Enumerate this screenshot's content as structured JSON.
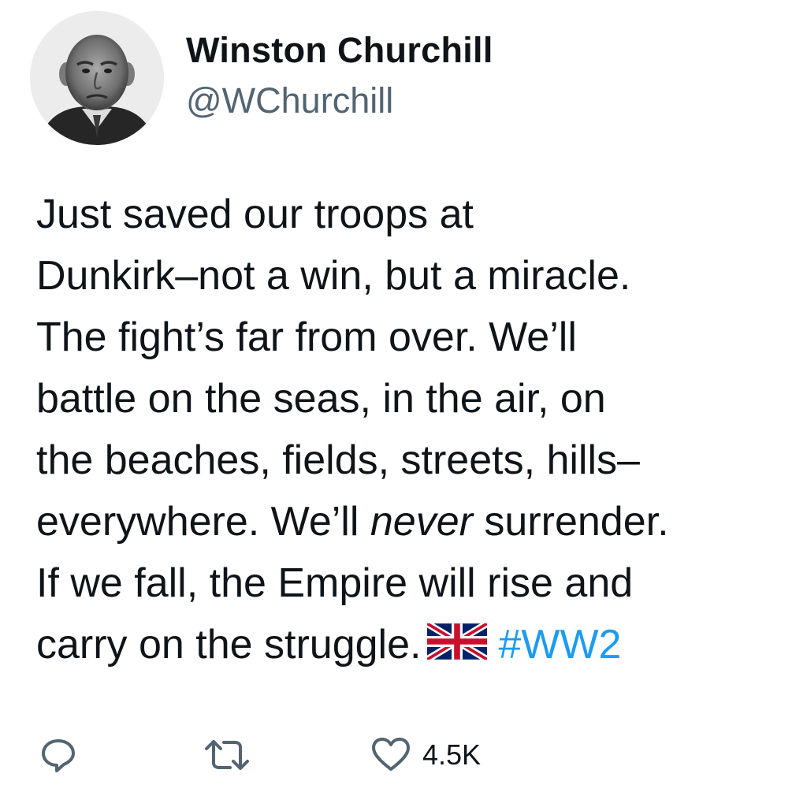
{
  "user": {
    "display_name": "Winston Churchill",
    "handle": "@WChurchill",
    "avatar_icon": "portrait-avatar"
  },
  "tweet": {
    "lines": [
      "Just saved our troops at",
      "Dunkirk–not a win, but a miracle.",
      "The fight’s far from over. We’ll",
      "battle on the seas, in the air, on",
      "the beaches, fields, streets, hills–"
    ],
    "line6_before": "everywhere. We’ll ",
    "line6_emphasis": "never",
    "line6_after": " surrender.",
    "line7": "If we fall, the Empire will rise and",
    "line8": "carry on the struggle.",
    "flag_icon": "union-jack-flag-icon",
    "hashtag": "#WW2"
  },
  "actions": {
    "reply_icon": "reply-icon",
    "retweet_icon": "retweet-icon",
    "like_icon": "heart-icon",
    "like_count": "4.5K"
  },
  "colors": {
    "text": "#0f1419",
    "handle": "#536471",
    "hashtag": "#1d9bf0",
    "icon": "#536471"
  }
}
